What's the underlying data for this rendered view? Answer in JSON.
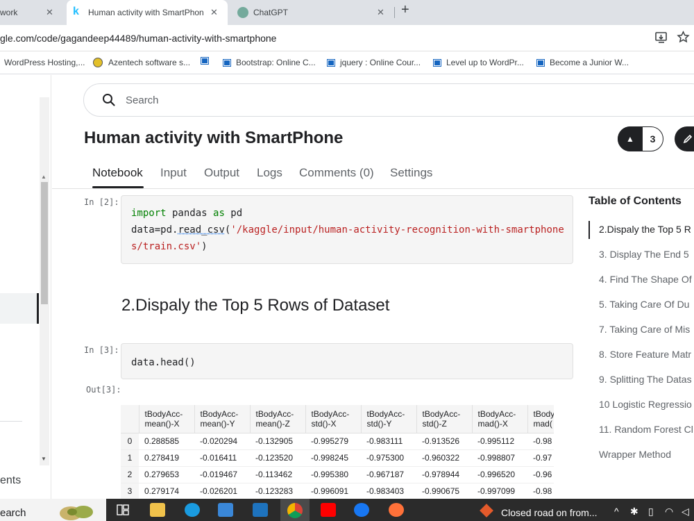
{
  "browser": {
    "tabs": [
      {
        "title": "work",
        "active": false
      },
      {
        "title": "Human activity with SmartPhon",
        "active": true,
        "favicon": "k"
      },
      {
        "title": "ChatGPT",
        "active": false
      }
    ],
    "close_glyph": "✕",
    "new_tab_glyph": "+",
    "url": "gle.com/code/gagandeep44489/human-activity-with-smartphone",
    "bookmarks": [
      "WordPress Hosting,...",
      "Azentech software s...",
      "",
      "Bootstrap: Online C...",
      "jquery : Online Cour...",
      "Level up to WordPr...",
      "Become a Junior W..."
    ]
  },
  "left_pane": {
    "partial_text": "ents"
  },
  "search": {
    "placeholder": "Search"
  },
  "notebook": {
    "title": "Human activity with SmartPhone",
    "upvotes": "3",
    "tabs": [
      "Notebook",
      "Input",
      "Output",
      "Logs",
      "Comments (0)",
      "Settings"
    ],
    "active_tab": "Notebook",
    "cells": [
      {
        "prompt": "In [2]:",
        "lines": [
          "import pandas as pd",
          "data=pd.read_csv('/kaggle/input/human-activity-recognition-with-smartphone",
          "s/train.csv')"
        ]
      },
      {
        "prompt": "In [3]:",
        "lines": [
          "data.head()"
        ]
      }
    ],
    "heading": "2.Dispaly the Top 5 Rows of Dataset",
    "out_prompt": "Out[3]:"
  },
  "table": {
    "columns": [
      [
        "tBodyAcc-",
        "mean()-X"
      ],
      [
        "tBodyAcc-",
        "mean()-Y"
      ],
      [
        "tBodyAcc-",
        "mean()-Z"
      ],
      [
        "tBodyAcc-",
        "std()-X"
      ],
      [
        "tBodyAcc-",
        "std()-Y"
      ],
      [
        "tBodyAcc-",
        "std()-Z"
      ],
      [
        "tBodyAcc-",
        "mad()-X"
      ],
      [
        "tBody",
        "mad("
      ]
    ],
    "rows": [
      {
        "idx": "0",
        "vals": [
          "0.288585",
          "-0.020294",
          "-0.132905",
          "-0.995279",
          "-0.983111",
          "-0.913526",
          "-0.995112",
          "-0.98"
        ]
      },
      {
        "idx": "1",
        "vals": [
          "0.278419",
          "-0.016411",
          "-0.123520",
          "-0.998245",
          "-0.975300",
          "-0.960322",
          "-0.998807",
          "-0.97"
        ]
      },
      {
        "idx": "2",
        "vals": [
          "0.279653",
          "-0.019467",
          "-0.113462",
          "-0.995380",
          "-0.967187",
          "-0.978944",
          "-0.996520",
          "-0.96"
        ]
      },
      {
        "idx": "3",
        "vals": [
          "0.279174",
          "-0.026201",
          "-0.123283",
          "-0.996091",
          "-0.983403",
          "-0.990675",
          "-0.997099",
          "-0.98"
        ]
      }
    ]
  },
  "toc": {
    "title": "Table of Contents",
    "items": [
      "2.Dispaly the Top 5 R",
      "3. Display The End 5",
      "4. Find The Shape Of",
      "5. Taking Care Of Du",
      "7. Taking Care of Mis",
      "8. Store Feature Matr",
      "9. Splitting The Datas",
      "10 Logistic Regressio",
      "11. Random Forest Cl",
      "Wrapper Method"
    ]
  },
  "taskbar": {
    "search_text": "earch",
    "news": "Closed road on from..."
  }
}
